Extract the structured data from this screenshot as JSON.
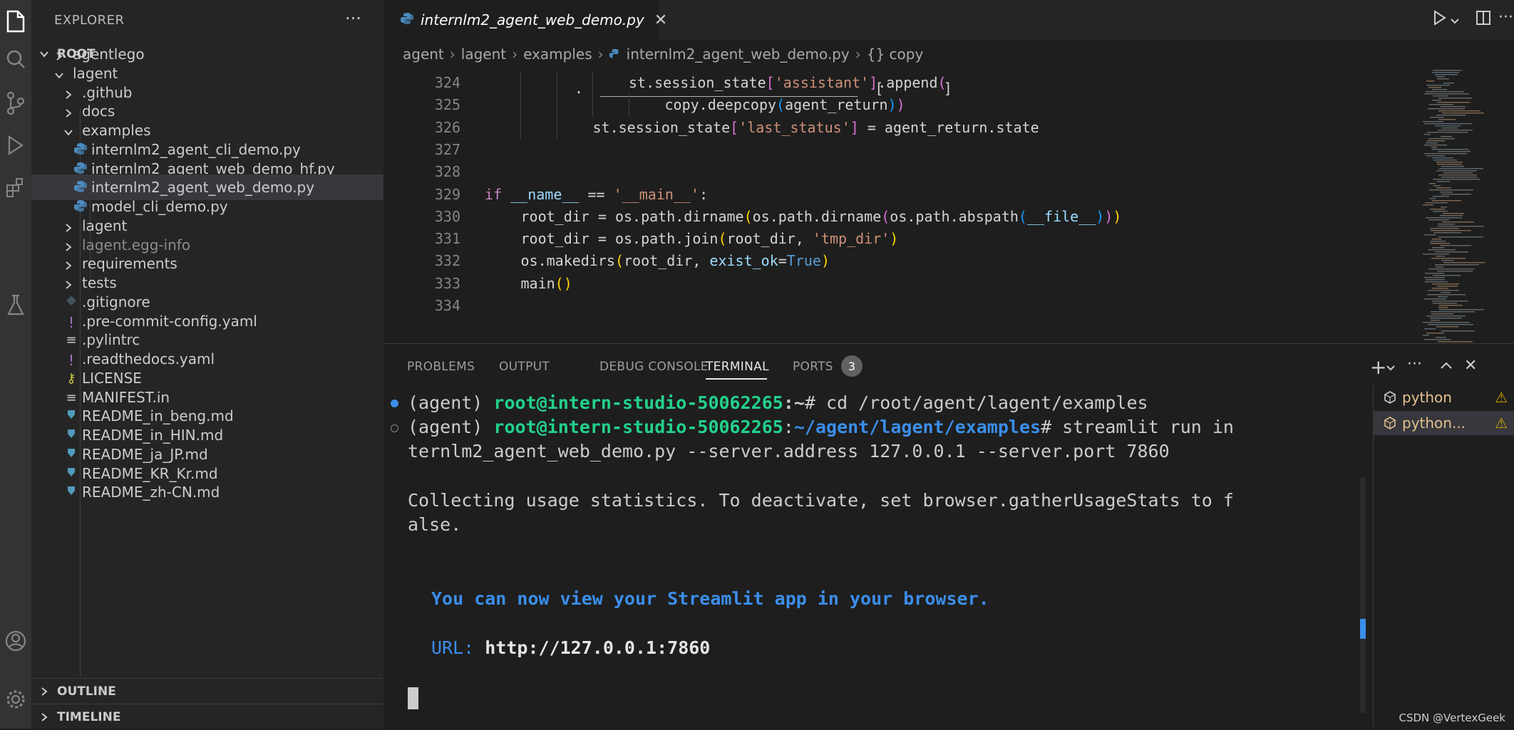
{
  "explorer": {
    "title": "EXPLORER",
    "more": "···",
    "root_label": "ROOT",
    "items": [
      {
        "label": "agentlego",
        "kind": "folder",
        "depth": 1,
        "open": false
      },
      {
        "label": "lagent",
        "kind": "folder",
        "depth": 1,
        "open": true
      },
      {
        "label": ".github",
        "kind": "folder",
        "depth": 2,
        "open": false
      },
      {
        "label": "docs",
        "kind": "folder",
        "depth": 2,
        "open": false
      },
      {
        "label": "examples",
        "kind": "folder",
        "depth": 2,
        "open": true
      },
      {
        "label": "internlm2_agent_cli_demo.py",
        "kind": "py",
        "depth": 3
      },
      {
        "label": "internlm2_agent_web_demo_hf.py",
        "kind": "py",
        "depth": 3
      },
      {
        "label": "internlm2_agent_web_demo.py",
        "kind": "py",
        "depth": 3,
        "selected": true
      },
      {
        "label": "model_cli_demo.py",
        "kind": "py",
        "depth": 3
      },
      {
        "label": "lagent",
        "kind": "folder",
        "depth": 2,
        "open": false
      },
      {
        "label": "lagent.egg-info",
        "kind": "folder",
        "depth": 2,
        "open": false,
        "dim": true
      },
      {
        "label": "requirements",
        "kind": "folder",
        "depth": 2,
        "open": false
      },
      {
        "label": "tests",
        "kind": "folder",
        "depth": 2,
        "open": false
      },
      {
        "label": ".gitignore",
        "kind": "git",
        "depth": 2
      },
      {
        "label": ".pre-commit-config.yaml",
        "kind": "yaml",
        "depth": 2
      },
      {
        "label": ".pylintrc",
        "kind": "text",
        "depth": 2
      },
      {
        "label": ".readthedocs.yaml",
        "kind": "yaml",
        "depth": 2
      },
      {
        "label": "LICENSE",
        "kind": "license",
        "depth": 2
      },
      {
        "label": "MANIFEST.in",
        "kind": "text",
        "depth": 2
      },
      {
        "label": "README_in_beng.md",
        "kind": "md",
        "depth": 2
      },
      {
        "label": "README_in_HIN.md",
        "kind": "md",
        "depth": 2
      },
      {
        "label": "README_ja_JP.md",
        "kind": "md",
        "depth": 2
      },
      {
        "label": "README_KR_Kr.md",
        "kind": "md",
        "depth": 2
      },
      {
        "label": "README_zh-CN.md",
        "kind": "md",
        "depth": 2
      }
    ],
    "outline": "OUTLINE",
    "timeline": "TIMELINE"
  },
  "editor": {
    "tab_label": "internlm2_agent_web_demo.py",
    "breadcrumb": [
      "agent",
      "lagent",
      "examples",
      "internlm2_agent_web_demo.py",
      "{} copy"
    ],
    "code_lines": [
      {
        "no": "324",
        "indent": 4,
        "tokens": [
          [
            "st.session_state",
            "#d4d4d4"
          ],
          [
            "[",
            "#da70d6"
          ],
          [
            "'assistant'",
            "#ce9178"
          ],
          [
            "]",
            "#da70d6"
          ],
          [
            ".append",
            "#d4d4d4"
          ],
          [
            "(",
            "#da70d6"
          ]
        ]
      },
      {
        "no": "325",
        "indent": 5,
        "tokens": [
          [
            "copy.deepcopy",
            "#d4d4d4"
          ],
          [
            "(",
            "#179fff"
          ],
          [
            "agent_return",
            "#d4d4d4"
          ],
          [
            ")",
            "#179fff"
          ],
          [
            ")",
            "#da70d6"
          ]
        ]
      },
      {
        "no": "326",
        "indent": 3,
        "tokens": [
          [
            "st.session_state",
            "#d4d4d4"
          ],
          [
            "[",
            "#da70d6"
          ],
          [
            "'last_status'",
            "#ce9178"
          ],
          [
            "]",
            "#da70d6"
          ],
          [
            " = agent_return.state",
            "#d4d4d4"
          ]
        ]
      },
      {
        "no": "327",
        "indent": 0,
        "tokens": []
      },
      {
        "no": "328",
        "indent": 0,
        "tokens": []
      },
      {
        "no": "329",
        "indent": 0,
        "tokens": [
          [
            "if",
            "#c586c0"
          ],
          [
            " ",
            "#d4d4d4"
          ],
          [
            "__name__",
            "#9cdcfe"
          ],
          [
            " == ",
            "#d4d4d4"
          ],
          [
            "'__main__'",
            "#ce9178"
          ],
          [
            ":",
            "#d4d4d4"
          ]
        ]
      },
      {
        "no": "330",
        "indent": 1,
        "tokens": [
          [
            "root_dir = os.path.dirname",
            "#d4d4d4"
          ],
          [
            "(",
            "#ffd700"
          ],
          [
            "os.path.dirname",
            "#d4d4d4"
          ],
          [
            "(",
            "#da70d6"
          ],
          [
            "os.path.abspath",
            "#d4d4d4"
          ],
          [
            "(",
            "#179fff"
          ],
          [
            "__file__",
            "#9cdcfe"
          ],
          [
            ")",
            "#179fff"
          ],
          [
            ")",
            "#da70d6"
          ],
          [
            ")",
            "#ffd700"
          ]
        ]
      },
      {
        "no": "331",
        "indent": 1,
        "tokens": [
          [
            "root_dir = os.path.join",
            "#d4d4d4"
          ],
          [
            "(",
            "#ffd700"
          ],
          [
            "root_dir, ",
            "#d4d4d4"
          ],
          [
            "'tmp_dir'",
            "#ce9178"
          ],
          [
            ")",
            "#ffd700"
          ]
        ]
      },
      {
        "no": "332",
        "indent": 1,
        "tokens": [
          [
            "os.makedirs",
            "#d4d4d4"
          ],
          [
            "(",
            "#ffd700"
          ],
          [
            "root_dir, ",
            "#d4d4d4"
          ],
          [
            "exist_ok",
            "#9cdcfe"
          ],
          [
            "=",
            "#d4d4d4"
          ],
          [
            "True",
            "#569cd6"
          ],
          [
            ")",
            "#ffd700"
          ]
        ]
      },
      {
        "no": "333",
        "indent": 1,
        "tokens": [
          [
            "main",
            "#d4d4d4"
          ],
          [
            "()",
            "#ffd700"
          ]
        ]
      },
      {
        "no": "334",
        "indent": 0,
        "tokens": []
      }
    ]
  },
  "panel": {
    "tabs": [
      "PROBLEMS",
      "OUTPUT",
      "DEBUG CONSOLE",
      "TERMINAL",
      "PORTS"
    ],
    "active_tab": "TERMINAL",
    "ports_badge": "3",
    "terminal": {
      "line1_env": "(agent) ",
      "line1_host": "root@intern-studio-50062265",
      "line1_path": ":~",
      "line1_cmd": "# cd /root/agent/lagent/examples",
      "line2_env": "(agent) ",
      "line2_host": "root@intern-studio-50062265",
      "line2_colon": ":",
      "line2_path": "~/agent/lagent/examples",
      "line2_cmd": "# streamlit run in",
      "line3": "ternlm2_agent_web_demo.py --server.address 127.0.0.1 --server.port 7860",
      "line4": "Collecting usage statistics. To deactivate, set browser.gatherUsageStats to f",
      "line5": "alse.",
      "line6": "You can now view your Streamlit app in your browser.",
      "url_label": "URL: ",
      "url_value": "http://127.0.0.1:7860"
    },
    "terminal_list": [
      {
        "label": "python",
        "selected": false
      },
      {
        "label": "python...",
        "selected": true
      }
    ]
  },
  "watermark": "CSDN @VertexGeek"
}
